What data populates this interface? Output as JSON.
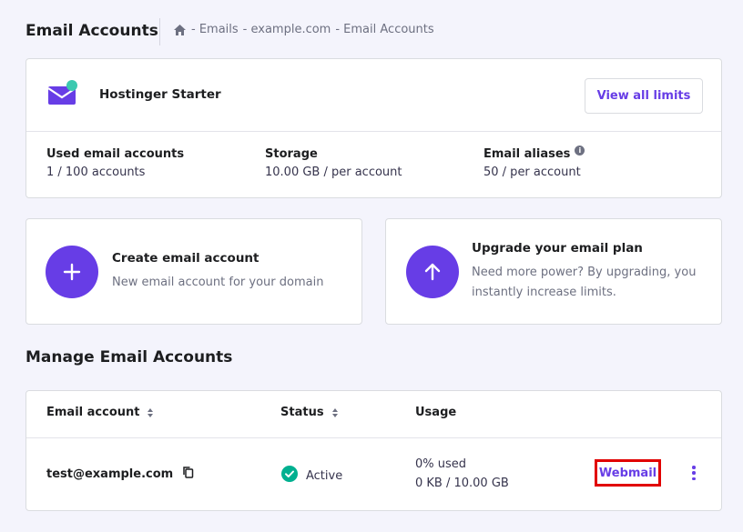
{
  "header": {
    "title": "Email Accounts",
    "breadcrumb": [
      "- Emails",
      "- example.com",
      "- Email Accounts"
    ]
  },
  "plan": {
    "name": "Hostinger Starter",
    "view_limits_label": "View all limits",
    "stats": [
      {
        "label": "Used email accounts",
        "value": "1 / 100 accounts"
      },
      {
        "label": "Storage",
        "value": "10.00 GB / per account"
      },
      {
        "label": "Email aliases",
        "value": "50 / per account"
      }
    ]
  },
  "actions": {
    "create": {
      "title": "Create email account",
      "desc": "New email account for your domain"
    },
    "upgrade": {
      "title": "Upgrade your email plan",
      "desc_line1": "Need more power? By upgrading, you",
      "desc_line2": "instantly increase limits."
    }
  },
  "manage": {
    "title": "Manage Email Accounts",
    "columns": {
      "email": "Email account",
      "status": "Status",
      "usage": "Usage"
    },
    "rows": [
      {
        "email": "test@example.com",
        "status": "Active",
        "usage_percent": "0% used",
        "usage_amount": "0 KB / 10.00 GB",
        "webmail_label": "Webmail"
      }
    ]
  },
  "colors": {
    "accent": "#673de6",
    "active_green": "#00b090",
    "highlight_red": "#e10000"
  }
}
